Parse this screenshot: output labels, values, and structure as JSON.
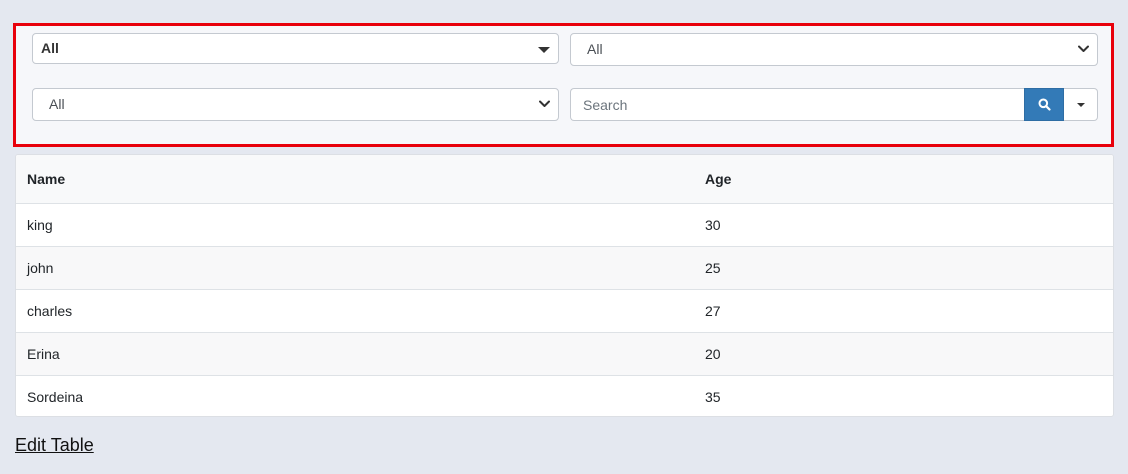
{
  "filters": {
    "select1": {
      "value": "All"
    },
    "select2": {
      "value": "All"
    },
    "select3": {
      "value": "All"
    },
    "search": {
      "placeholder": "Search",
      "value": ""
    }
  },
  "icons": {
    "search_button": "search-icon",
    "dropdown_button": "caret-down-icon"
  },
  "colors": {
    "highlight_border": "#e8000b",
    "search_button": "#337ab7"
  },
  "table": {
    "columns": [
      "Name",
      "Age"
    ],
    "rows": [
      {
        "name": "king",
        "age": "30"
      },
      {
        "name": "john",
        "age": "25"
      },
      {
        "name": "charles",
        "age": "27"
      },
      {
        "name": "Erina",
        "age": "20"
      },
      {
        "name": "Sordeina",
        "age": "35"
      }
    ]
  },
  "footer": {
    "edit_link": "Edit Table"
  }
}
